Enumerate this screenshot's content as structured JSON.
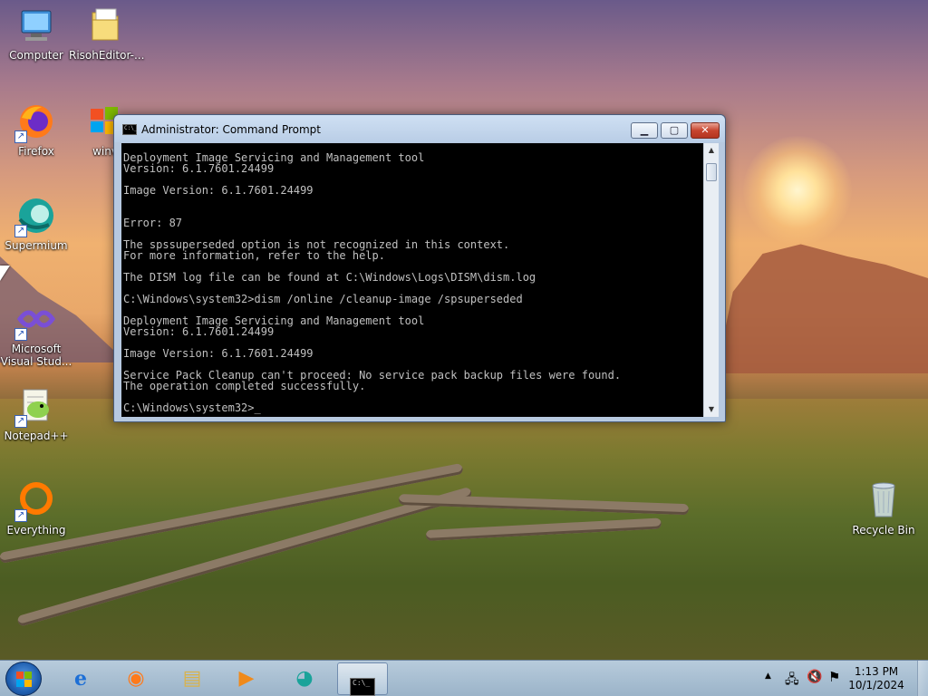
{
  "desktop": {
    "icons": [
      {
        "label": "Computer",
        "icon": "computer-icon"
      },
      {
        "label": "RisohEditor-...",
        "icon": "folder-icon"
      },
      {
        "label": "Firefox",
        "icon": "firefox-icon"
      },
      {
        "label": "winv",
        "icon": "windows-logo-icon"
      },
      {
        "label": "Supermium",
        "icon": "supermium-icon"
      },
      {
        "label": "Microsoft Visual Stud...",
        "icon": "visual-studio-icon"
      },
      {
        "label": "Notepad++",
        "icon": "notepadpp-icon"
      },
      {
        "label": "Everything",
        "icon": "everything-icon"
      },
      {
        "label": "Recycle Bin",
        "icon": "recycle-bin-icon"
      }
    ]
  },
  "cmd": {
    "title": "Administrator: Command Prompt",
    "icon_text": "C:\\_",
    "buttons": {
      "minimize": "▁",
      "maximize": "▢",
      "close": "✕"
    },
    "lines": [
      "Deployment Image Servicing and Management tool",
      "Version: 6.1.7601.24499",
      "",
      "Image Version: 6.1.7601.24499",
      "",
      "",
      "Error: 87",
      "",
      "The spssuperseded option is not recognized in this context.",
      "For more information, refer to the help.",
      "",
      "The DISM log file can be found at C:\\Windows\\Logs\\DISM\\dism.log",
      "",
      "C:\\Windows\\system32>dism /online /cleanup-image /spsuperseded",
      "",
      "Deployment Image Servicing and Management tool",
      "Version: 6.1.7601.24499",
      "",
      "Image Version: 6.1.7601.24499",
      "",
      "Service Pack Cleanup can't proceed: No service pack backup files were found.",
      "The operation completed successfully.",
      "",
      "C:\\Windows\\system32>_"
    ]
  },
  "taskbar": {
    "pinned": [
      {
        "name": "internet-explorer-icon",
        "glyph": "e"
      },
      {
        "name": "firefox-icon",
        "glyph": "◉"
      },
      {
        "name": "file-explorer-icon",
        "glyph": "▤"
      },
      {
        "name": "media-player-icon",
        "glyph": "▶"
      },
      {
        "name": "supermium-icon",
        "glyph": "◕"
      },
      {
        "name": "command-prompt-icon",
        "glyph": "C:\\_"
      }
    ],
    "tray": {
      "show_hidden": "▲",
      "network": "🖧",
      "volume": "🔇",
      "flag": "⚑"
    },
    "clock": {
      "time": "1:13 PM",
      "date": "10/1/2024"
    }
  },
  "colors": {
    "console_bg": "#000000",
    "console_text": "#c0c0c0",
    "titlebar": "#b9cde6",
    "close_button": "#c7452f"
  }
}
